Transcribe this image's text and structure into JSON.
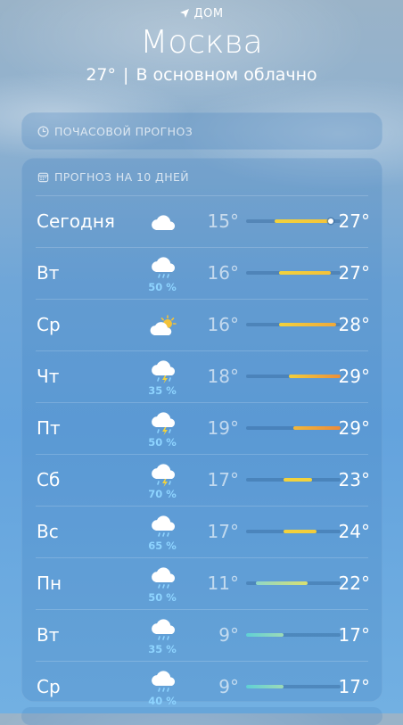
{
  "location": {
    "label": "ДОМ",
    "icon": "location-arrow-icon"
  },
  "city": "Москва",
  "current": {
    "temp": "27°",
    "separator": "|",
    "condition": "В основном облачно"
  },
  "hourly": {
    "title": "ПОЧАСОВОЙ ПРОГНОЗ",
    "icon": "clock-icon"
  },
  "daily": {
    "title": "ПРОГНОЗ НА 10 ДНЕЙ",
    "icon": "calendar-icon",
    "range_min": 9,
    "range_max": 29,
    "current_temp": 27,
    "days": [
      {
        "day": "Сегодня",
        "icon": "cloud-icon",
        "precip": "",
        "low": "15°",
        "high": "27°",
        "low_v": 15,
        "high_v": 27,
        "grad": [
          "#f2d23c",
          "#f5c43a"
        ],
        "now": true
      },
      {
        "day": "Вт",
        "icon": "cloud-rain-icon",
        "precip": "50 %",
        "low": "16°",
        "high": "27°",
        "low_v": 16,
        "high_v": 27,
        "grad": [
          "#f2d23c",
          "#f3c13a"
        ]
      },
      {
        "day": "Ср",
        "icon": "sun-cloud-icon",
        "precip": "",
        "low": "16°",
        "high": "28°",
        "low_v": 16,
        "high_v": 28,
        "grad": [
          "#f2d23c",
          "#efa83a"
        ]
      },
      {
        "day": "Чт",
        "icon": "cloud-thunder-icon",
        "precip": "35 %",
        "low": "18°",
        "high": "29°",
        "low_v": 18,
        "high_v": 29,
        "grad": [
          "#f3cf3a",
          "#eb8f3a"
        ]
      },
      {
        "day": "Пт",
        "icon": "cloud-thunder-icon",
        "precip": "50 %",
        "low": "19°",
        "high": "29°",
        "low_v": 19,
        "high_v": 29,
        "grad": [
          "#f2b83a",
          "#eb8a3a"
        ]
      },
      {
        "day": "Сб",
        "icon": "cloud-thunder-icon",
        "precip": "70 %",
        "low": "17°",
        "high": "23°",
        "low_v": 17,
        "high_v": 23,
        "grad": [
          "#f2d23c",
          "#f2d23c"
        ]
      },
      {
        "day": "Вс",
        "icon": "cloud-rain-icon",
        "precip": "65 %",
        "low": "17°",
        "high": "24°",
        "low_v": 17,
        "high_v": 24,
        "grad": [
          "#f2d23c",
          "#f2cc3c"
        ]
      },
      {
        "day": "Пн",
        "icon": "cloud-rain-icon",
        "precip": "50 %",
        "low": "11°",
        "high": "22°",
        "low_v": 11,
        "high_v": 22,
        "grad": [
          "#8fd7c8",
          "#d9e070"
        ]
      },
      {
        "day": "Вт",
        "icon": "cloud-rain-icon",
        "precip": "35 %",
        "low": "9°",
        "high": "17°",
        "low_v": 9,
        "high_v": 17,
        "grad": [
          "#5fd0d6",
          "#9ddbb6"
        ]
      },
      {
        "day": "Ср",
        "icon": "cloud-rain-icon",
        "precip": "40 %",
        "low": "9°",
        "high": "17°",
        "low_v": 9,
        "high_v": 17,
        "grad": [
          "#5fd0d6",
          "#9ddbb6"
        ]
      }
    ]
  }
}
